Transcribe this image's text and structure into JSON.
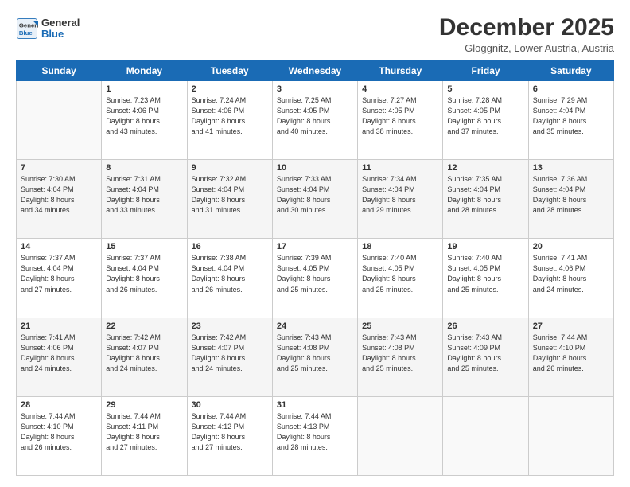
{
  "header": {
    "logo_line1": "General",
    "logo_line2": "Blue",
    "month_title": "December 2025",
    "location": "Gloggnitz, Lower Austria, Austria"
  },
  "days_of_week": [
    "Sunday",
    "Monday",
    "Tuesday",
    "Wednesday",
    "Thursday",
    "Friday",
    "Saturday"
  ],
  "weeks": [
    [
      {
        "num": "",
        "info": ""
      },
      {
        "num": "1",
        "info": "Sunrise: 7:23 AM\nSunset: 4:06 PM\nDaylight: 8 hours\nand 43 minutes."
      },
      {
        "num": "2",
        "info": "Sunrise: 7:24 AM\nSunset: 4:06 PM\nDaylight: 8 hours\nand 41 minutes."
      },
      {
        "num": "3",
        "info": "Sunrise: 7:25 AM\nSunset: 4:05 PM\nDaylight: 8 hours\nand 40 minutes."
      },
      {
        "num": "4",
        "info": "Sunrise: 7:27 AM\nSunset: 4:05 PM\nDaylight: 8 hours\nand 38 minutes."
      },
      {
        "num": "5",
        "info": "Sunrise: 7:28 AM\nSunset: 4:05 PM\nDaylight: 8 hours\nand 37 minutes."
      },
      {
        "num": "6",
        "info": "Sunrise: 7:29 AM\nSunset: 4:04 PM\nDaylight: 8 hours\nand 35 minutes."
      }
    ],
    [
      {
        "num": "7",
        "info": "Sunrise: 7:30 AM\nSunset: 4:04 PM\nDaylight: 8 hours\nand 34 minutes."
      },
      {
        "num": "8",
        "info": "Sunrise: 7:31 AM\nSunset: 4:04 PM\nDaylight: 8 hours\nand 33 minutes."
      },
      {
        "num": "9",
        "info": "Sunrise: 7:32 AM\nSunset: 4:04 PM\nDaylight: 8 hours\nand 31 minutes."
      },
      {
        "num": "10",
        "info": "Sunrise: 7:33 AM\nSunset: 4:04 PM\nDaylight: 8 hours\nand 30 minutes."
      },
      {
        "num": "11",
        "info": "Sunrise: 7:34 AM\nSunset: 4:04 PM\nDaylight: 8 hours\nand 29 minutes."
      },
      {
        "num": "12",
        "info": "Sunrise: 7:35 AM\nSunset: 4:04 PM\nDaylight: 8 hours\nand 28 minutes."
      },
      {
        "num": "13",
        "info": "Sunrise: 7:36 AM\nSunset: 4:04 PM\nDaylight: 8 hours\nand 28 minutes."
      }
    ],
    [
      {
        "num": "14",
        "info": "Sunrise: 7:37 AM\nSunset: 4:04 PM\nDaylight: 8 hours\nand 27 minutes."
      },
      {
        "num": "15",
        "info": "Sunrise: 7:37 AM\nSunset: 4:04 PM\nDaylight: 8 hours\nand 26 minutes."
      },
      {
        "num": "16",
        "info": "Sunrise: 7:38 AM\nSunset: 4:04 PM\nDaylight: 8 hours\nand 26 minutes."
      },
      {
        "num": "17",
        "info": "Sunrise: 7:39 AM\nSunset: 4:05 PM\nDaylight: 8 hours\nand 25 minutes."
      },
      {
        "num": "18",
        "info": "Sunrise: 7:40 AM\nSunset: 4:05 PM\nDaylight: 8 hours\nand 25 minutes."
      },
      {
        "num": "19",
        "info": "Sunrise: 7:40 AM\nSunset: 4:05 PM\nDaylight: 8 hours\nand 25 minutes."
      },
      {
        "num": "20",
        "info": "Sunrise: 7:41 AM\nSunset: 4:06 PM\nDaylight: 8 hours\nand 24 minutes."
      }
    ],
    [
      {
        "num": "21",
        "info": "Sunrise: 7:41 AM\nSunset: 4:06 PM\nDaylight: 8 hours\nand 24 minutes."
      },
      {
        "num": "22",
        "info": "Sunrise: 7:42 AM\nSunset: 4:07 PM\nDaylight: 8 hours\nand 24 minutes."
      },
      {
        "num": "23",
        "info": "Sunrise: 7:42 AM\nSunset: 4:07 PM\nDaylight: 8 hours\nand 24 minutes."
      },
      {
        "num": "24",
        "info": "Sunrise: 7:43 AM\nSunset: 4:08 PM\nDaylight: 8 hours\nand 25 minutes."
      },
      {
        "num": "25",
        "info": "Sunrise: 7:43 AM\nSunset: 4:08 PM\nDaylight: 8 hours\nand 25 minutes."
      },
      {
        "num": "26",
        "info": "Sunrise: 7:43 AM\nSunset: 4:09 PM\nDaylight: 8 hours\nand 25 minutes."
      },
      {
        "num": "27",
        "info": "Sunrise: 7:44 AM\nSunset: 4:10 PM\nDaylight: 8 hours\nand 26 minutes."
      }
    ],
    [
      {
        "num": "28",
        "info": "Sunrise: 7:44 AM\nSunset: 4:10 PM\nDaylight: 8 hours\nand 26 minutes."
      },
      {
        "num": "29",
        "info": "Sunrise: 7:44 AM\nSunset: 4:11 PM\nDaylight: 8 hours\nand 27 minutes."
      },
      {
        "num": "30",
        "info": "Sunrise: 7:44 AM\nSunset: 4:12 PM\nDaylight: 8 hours\nand 27 minutes."
      },
      {
        "num": "31",
        "info": "Sunrise: 7:44 AM\nSunset: 4:13 PM\nDaylight: 8 hours\nand 28 minutes."
      },
      {
        "num": "",
        "info": ""
      },
      {
        "num": "",
        "info": ""
      },
      {
        "num": "",
        "info": ""
      }
    ]
  ]
}
